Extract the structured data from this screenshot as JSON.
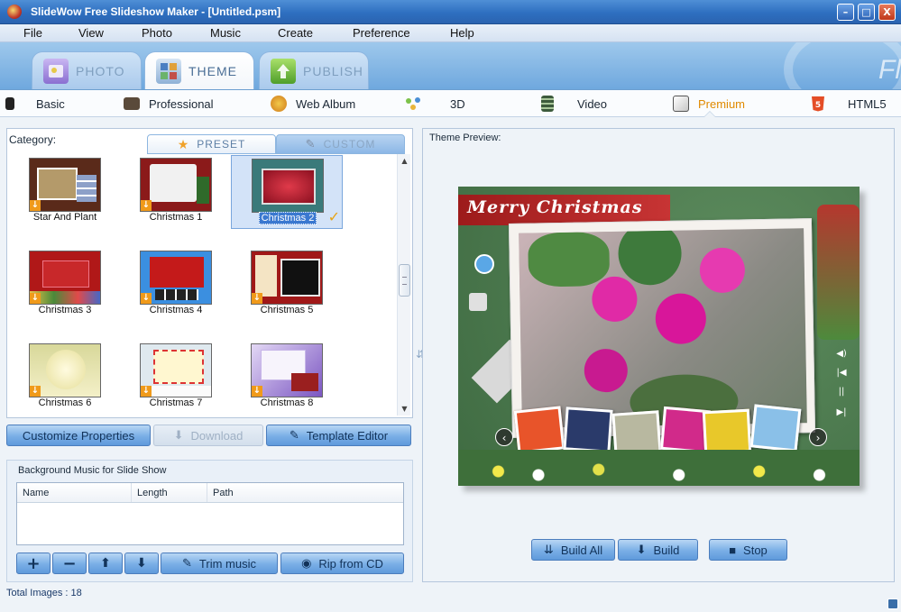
{
  "window": {
    "title": "SlideWow Free Slideshow Maker - [Untitled.psm]",
    "min": "–",
    "max": "□",
    "close": "X"
  },
  "menu": [
    "File",
    "View",
    "Photo",
    "Music",
    "Create",
    "Preference",
    "Help"
  ],
  "main_tabs": [
    {
      "label": "PHOTO",
      "icon": "photo-tab-icon"
    },
    {
      "label": "THEME",
      "icon": "theme-tab-icon",
      "active": true
    },
    {
      "label": "PUBLISH",
      "icon": "publish-tab-icon"
    }
  ],
  "brand_watermark": "Fl",
  "sub_tabs": [
    {
      "label": "Basic",
      "icon": "piano-icon"
    },
    {
      "label": "Professional",
      "icon": "briefcase-icon"
    },
    {
      "label": "Web Album",
      "icon": "globe-icon"
    },
    {
      "label": "3D",
      "icon": "molecule-icon"
    },
    {
      "label": "Video",
      "icon": "film-icon"
    },
    {
      "label": "Premium",
      "icon": "premium-icon",
      "selected": true
    },
    {
      "label": "HTML5",
      "icon": "html5-icon"
    }
  ],
  "category": {
    "label": "Category:",
    "tabs": {
      "preset": "PRESET",
      "custom": "CUSTOM"
    },
    "items": [
      {
        "label": "Star And Plant"
      },
      {
        "label": "Christmas 1"
      },
      {
        "label": "Christmas 2",
        "selected": true
      },
      {
        "label": "Christmas 3"
      },
      {
        "label": "Christmas 4"
      },
      {
        "label": "Christmas 5"
      },
      {
        "label": "Christmas 6"
      },
      {
        "label": "Christmas 7"
      },
      {
        "label": "Christmas 8"
      }
    ]
  },
  "actions": {
    "customize": "Customize Properties",
    "download": "Download",
    "template_editor": "Template Editor"
  },
  "music": {
    "title": "Background Music for Slide Show",
    "columns": [
      "Name",
      "Length",
      "Path"
    ],
    "buttons": {
      "add": "+",
      "remove": "−",
      "up": "⬆",
      "down": "⬇",
      "trim": "Trim music",
      "rip": "Rip from CD"
    }
  },
  "preview": {
    "label": "Theme Preview:",
    "banner": "Merry Christmas"
  },
  "build": {
    "build_all": "Build All",
    "build": "Build",
    "stop": "Stop"
  },
  "status": {
    "total_images": "Total Images : 18"
  },
  "colors": {
    "accent": "#e08a00",
    "titlebar": "#2e6fc0",
    "button": "#79aee6"
  }
}
